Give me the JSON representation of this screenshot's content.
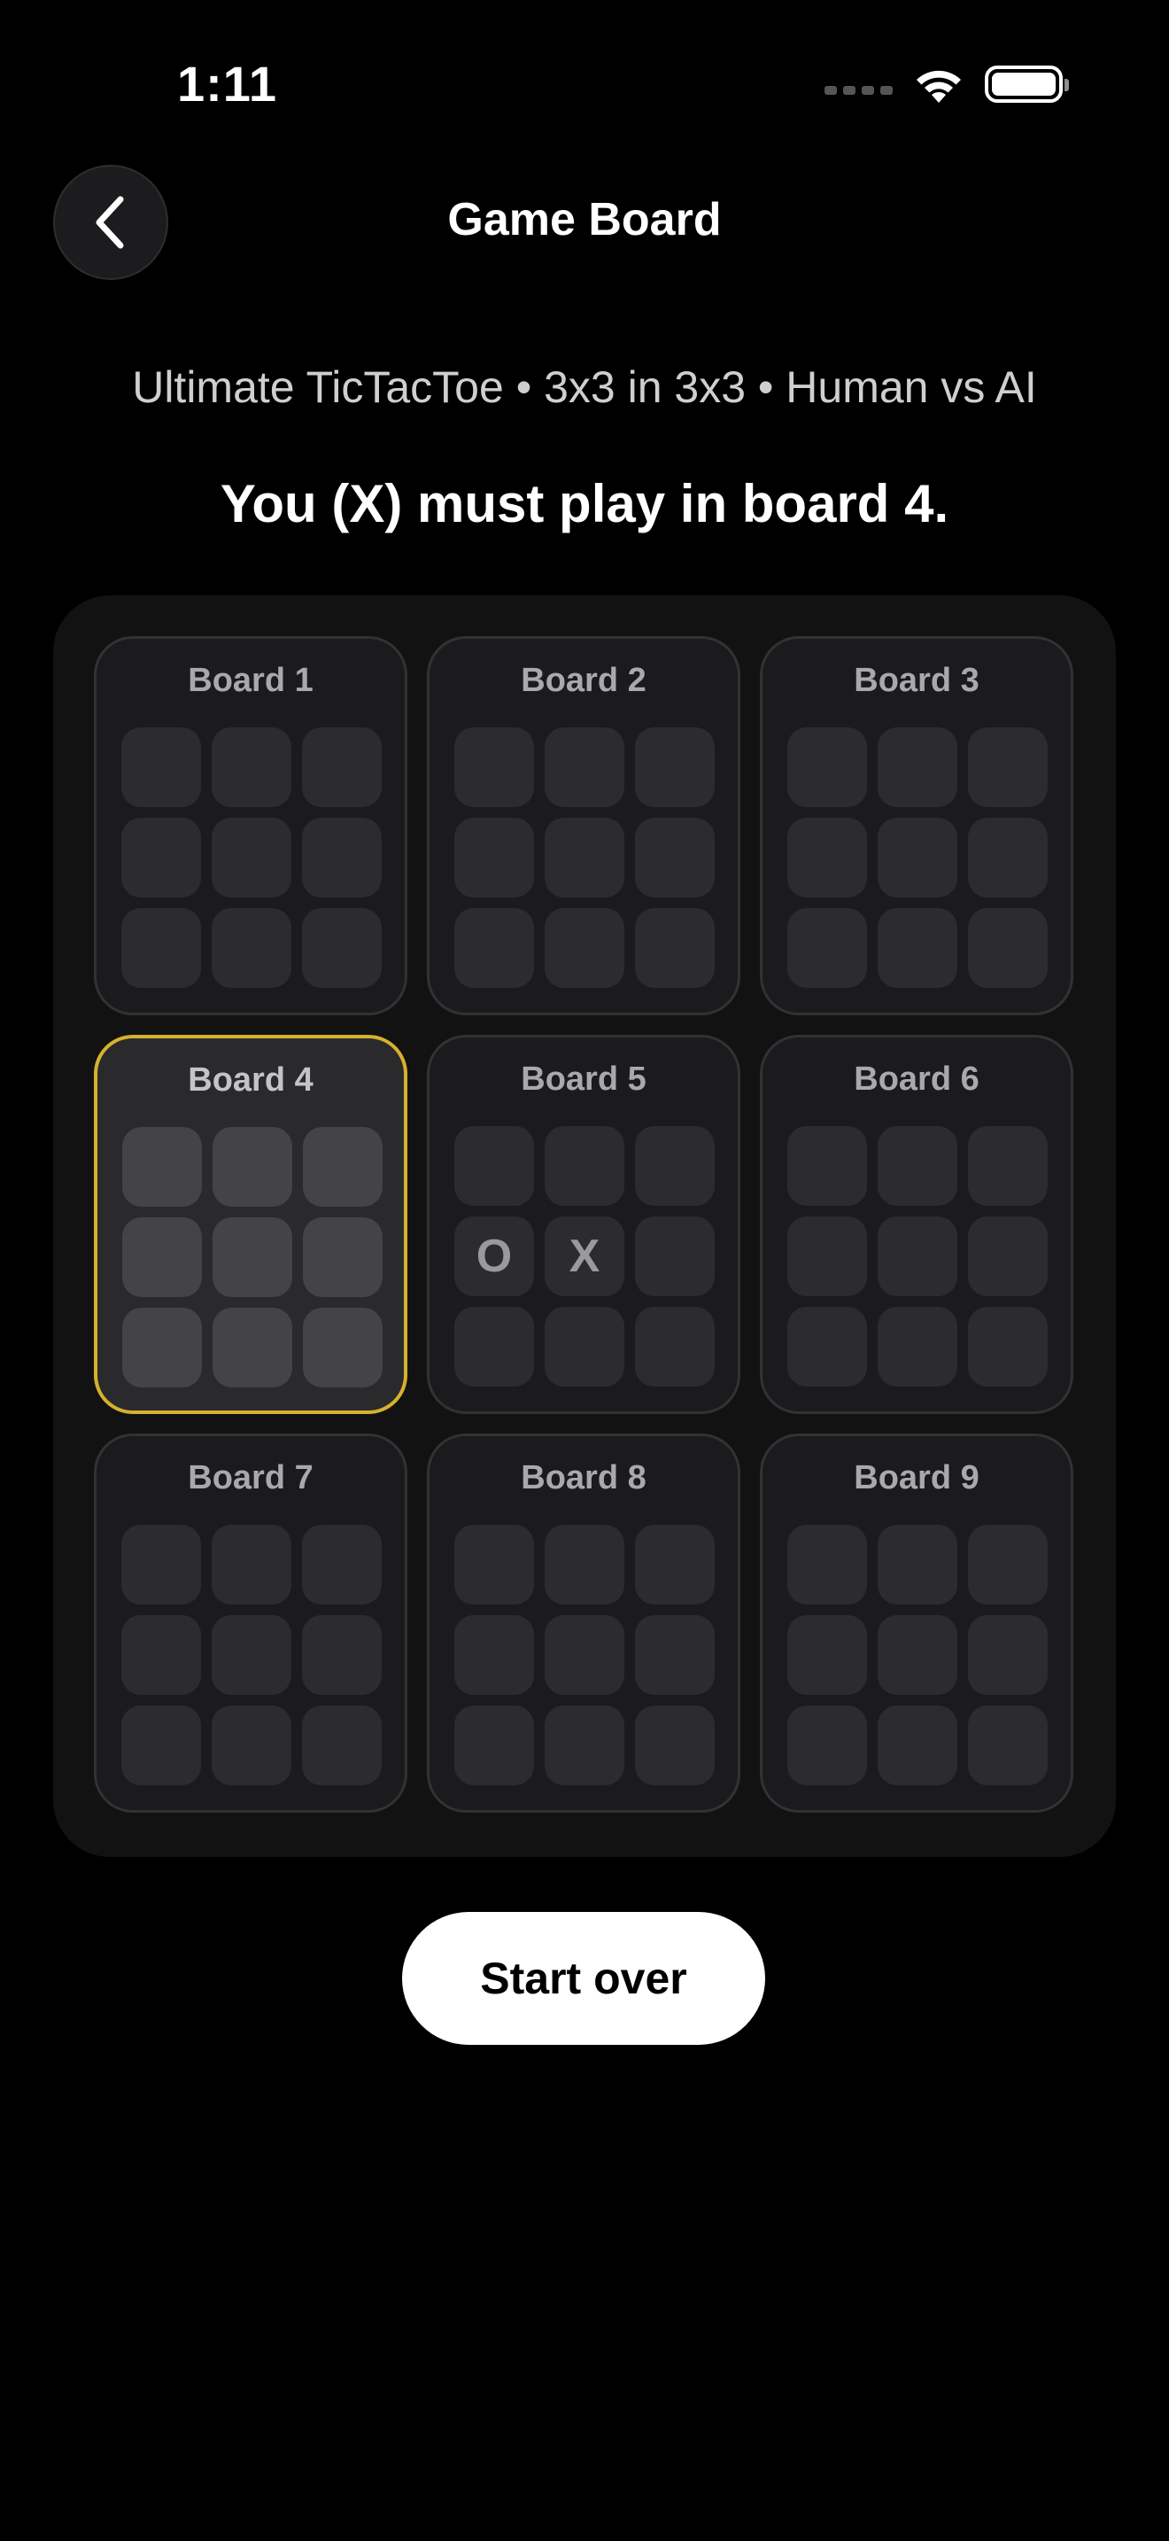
{
  "status_bar": {
    "time": "1:11"
  },
  "nav": {
    "back_icon": "chevron-left-icon",
    "title": "Game Board"
  },
  "subtitle": "Ultimate TicTacToe • 3x3 in 3x3 • Human vs AI",
  "turn_message": "You (X) must play in board 4.",
  "colors": {
    "background": "#000000",
    "active_board_border": "#d7b12e",
    "board_container": "#121212",
    "cell": "#2c2c2e",
    "active_cell": "#444446"
  },
  "active_board": 4,
  "boards": [
    {
      "title": "Board 1",
      "cells": [
        "",
        "",
        "",
        "",
        "",
        "",
        "",
        "",
        ""
      ]
    },
    {
      "title": "Board 2",
      "cells": [
        "",
        "",
        "",
        "",
        "",
        "",
        "",
        "",
        ""
      ]
    },
    {
      "title": "Board 3",
      "cells": [
        "",
        "",
        "",
        "",
        "",
        "",
        "",
        "",
        ""
      ]
    },
    {
      "title": "Board 4",
      "cells": [
        "",
        "",
        "",
        "",
        "",
        "",
        "",
        "",
        ""
      ]
    },
    {
      "title": "Board 5",
      "cells": [
        "",
        "",
        "",
        "O",
        "X",
        "",
        "",
        "",
        ""
      ]
    },
    {
      "title": "Board 6",
      "cells": [
        "",
        "",
        "",
        "",
        "",
        "",
        "",
        "",
        ""
      ]
    },
    {
      "title": "Board 7",
      "cells": [
        "",
        "",
        "",
        "",
        "",
        "",
        "",
        "",
        ""
      ]
    },
    {
      "title": "Board 8",
      "cells": [
        "",
        "",
        "",
        "",
        "",
        "",
        "",
        "",
        ""
      ]
    },
    {
      "title": "Board 9",
      "cells": [
        "",
        "",
        "",
        "",
        "",
        "",
        "",
        "",
        ""
      ]
    }
  ],
  "start_over_label": "Start over"
}
